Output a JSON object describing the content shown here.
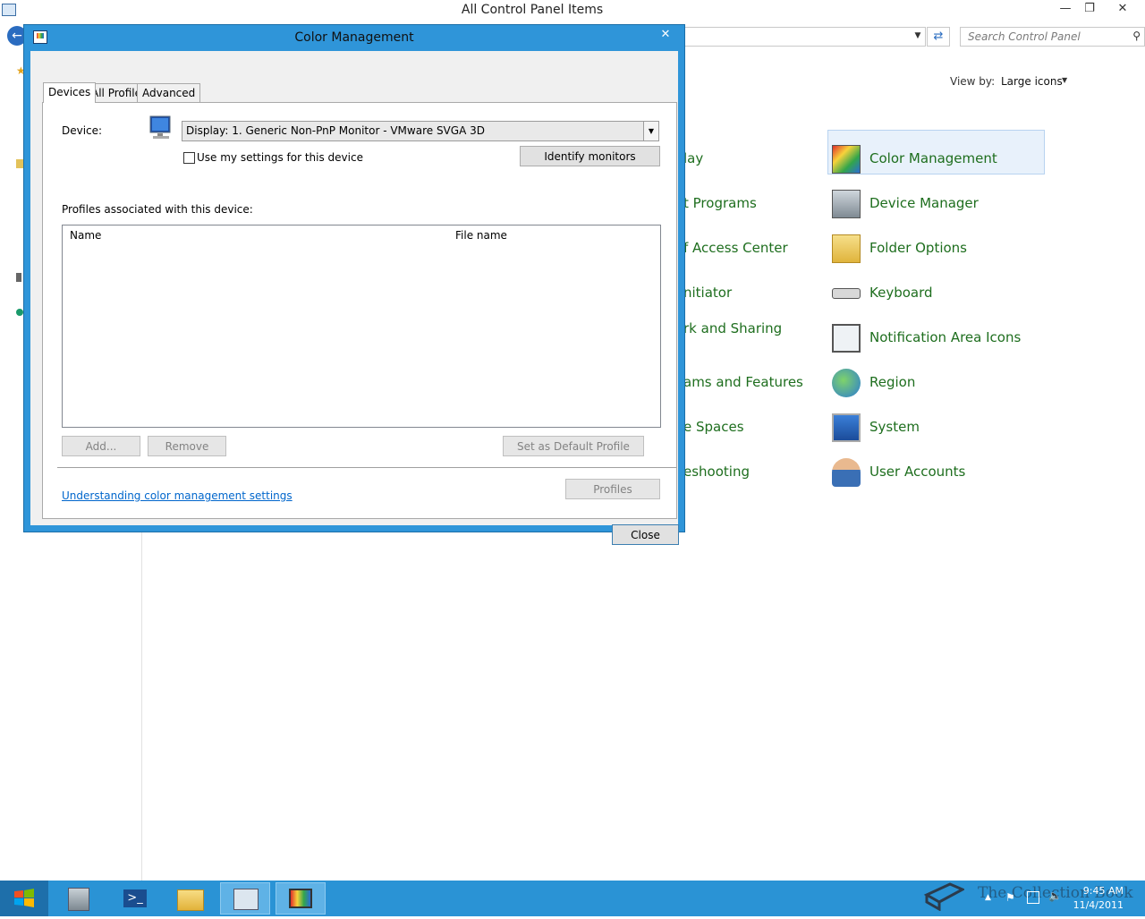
{
  "control_panel": {
    "title": "All Control Panel Items",
    "search_placeholder": "Search Control Panel",
    "view_by_label": "View by:",
    "view_by_value": "Large icons",
    "items_left_partial": [
      "lay",
      "t Programs",
      "f Access Center",
      "nitiator",
      "rk and Sharing",
      "ams and Features",
      "e Spaces",
      "eshooting"
    ],
    "items_right": [
      "Color Management",
      "Device Manager",
      "Folder Options",
      "Keyboard",
      "Notification Area Icons",
      "Region",
      "System",
      "User Accounts"
    ]
  },
  "dialog": {
    "title": "Color Management",
    "tabs": [
      "Devices",
      "All Profiles",
      "Advanced"
    ],
    "active_tab": "Devices",
    "device_label": "Device:",
    "device_value": "Display: 1. Generic Non-PnP Monitor - VMware SVGA 3D",
    "use_settings_label": "Use my settings for this device",
    "use_settings_checked": false,
    "identify_button": "Identify monitors",
    "profiles_label": "Profiles associated with this device:",
    "columns": [
      "Name",
      "File name"
    ],
    "rows": [],
    "add_button": "Add...",
    "remove_button": "Remove",
    "set_default_button": "Set as Default Profile",
    "link": "Understanding color management settings",
    "profiles_button": "Profiles",
    "close_button": "Close"
  },
  "taskbar": {
    "time": "9:45 AM",
    "date": "11/4/2011",
    "watermark": "The Collection Book"
  },
  "colors": {
    "accent": "#2f95d9",
    "link": "#0066cc",
    "cp_item": "#1e6e1e"
  }
}
